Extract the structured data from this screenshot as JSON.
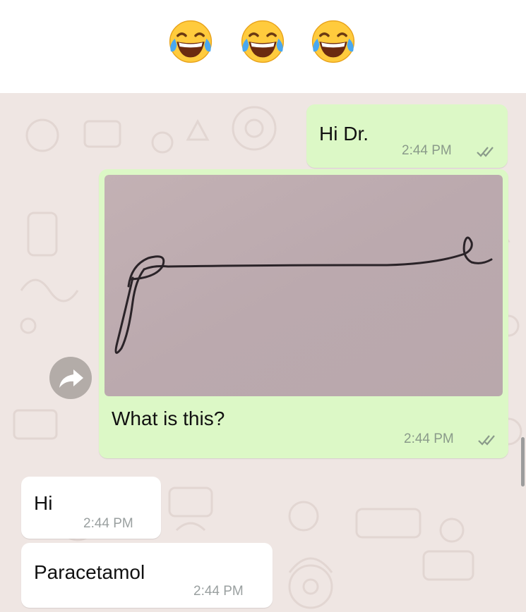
{
  "header": {
    "emojis": [
      "face-with-tears-of-joy-icon",
      "face-with-tears-of-joy-icon",
      "face-with-tears-of-joy-icon"
    ]
  },
  "messages": [
    {
      "direction": "outgoing",
      "text": "Hi Dr.",
      "time": "2:44 PM",
      "status": "read"
    },
    {
      "direction": "outgoing",
      "type": "image",
      "image": "handwritten-signature",
      "caption": "What is this?",
      "time": "2:44 PM",
      "status": "read"
    },
    {
      "direction": "incoming",
      "text": "Hi",
      "time": "2:44 PM"
    },
    {
      "direction": "incoming",
      "text": "Paracetamol",
      "time": "2:44 PM"
    }
  ],
  "colors": {
    "chat_background": "#efe6e3",
    "outgoing_bubble": "#dcf8c6",
    "incoming_bubble": "#ffffff",
    "read_ticks": "#8a9a8a"
  }
}
